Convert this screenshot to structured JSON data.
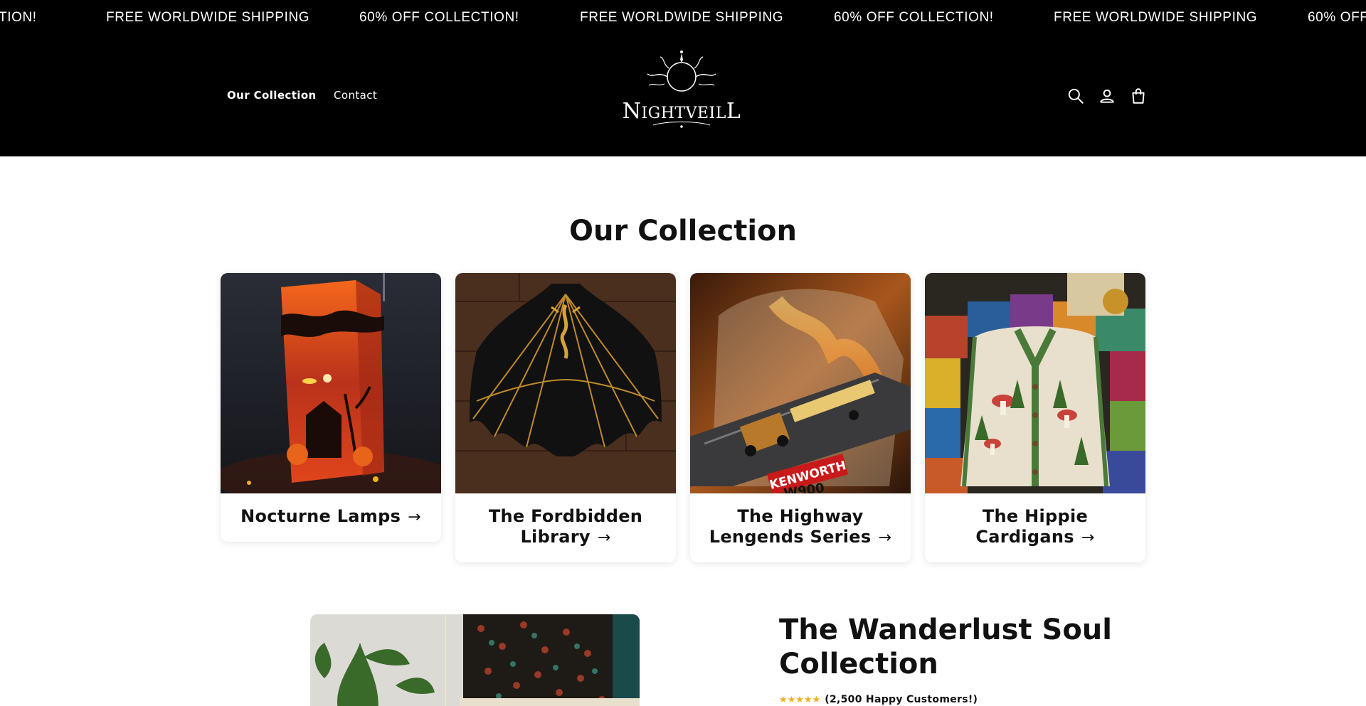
{
  "announcement": {
    "messages": [
      "TION!",
      "FREE WORLDWIDE SHIPPING",
      "60% OFF COLLECTION!",
      "FREE WORLDWIDE SHIPPING",
      "60% OFF COLLECTION!",
      "FREE WORLDWIDE SHIPPING",
      "60% OFF"
    ]
  },
  "header": {
    "nav": [
      {
        "label": "Our Collection",
        "active": true
      },
      {
        "label": "Contact",
        "active": false
      }
    ],
    "logo_text": "NIGHTVEILL",
    "icons": [
      "search-icon",
      "account-icon",
      "cart-icon"
    ]
  },
  "collection": {
    "title": "Our Collection",
    "cards": [
      {
        "title": "Nocturne Lamps",
        "arrow": "→"
      },
      {
        "title": "The Fordbidden Library",
        "arrow": "→"
      },
      {
        "title": "The Highway Lengends Series",
        "arrow": "→"
      },
      {
        "title": "The Hippie Cardigans",
        "arrow": "→"
      }
    ],
    "truck_plate": "KENWORTH",
    "truck_model": "W900"
  },
  "feature": {
    "title": "The Wanderlust Soul Collection",
    "stars": "★★★★★",
    "rating_text": "(2,500 Happy Customers!)"
  },
  "colors": {
    "header_bg": "#000000",
    "star": "#f2b01e",
    "text": "#111111"
  }
}
